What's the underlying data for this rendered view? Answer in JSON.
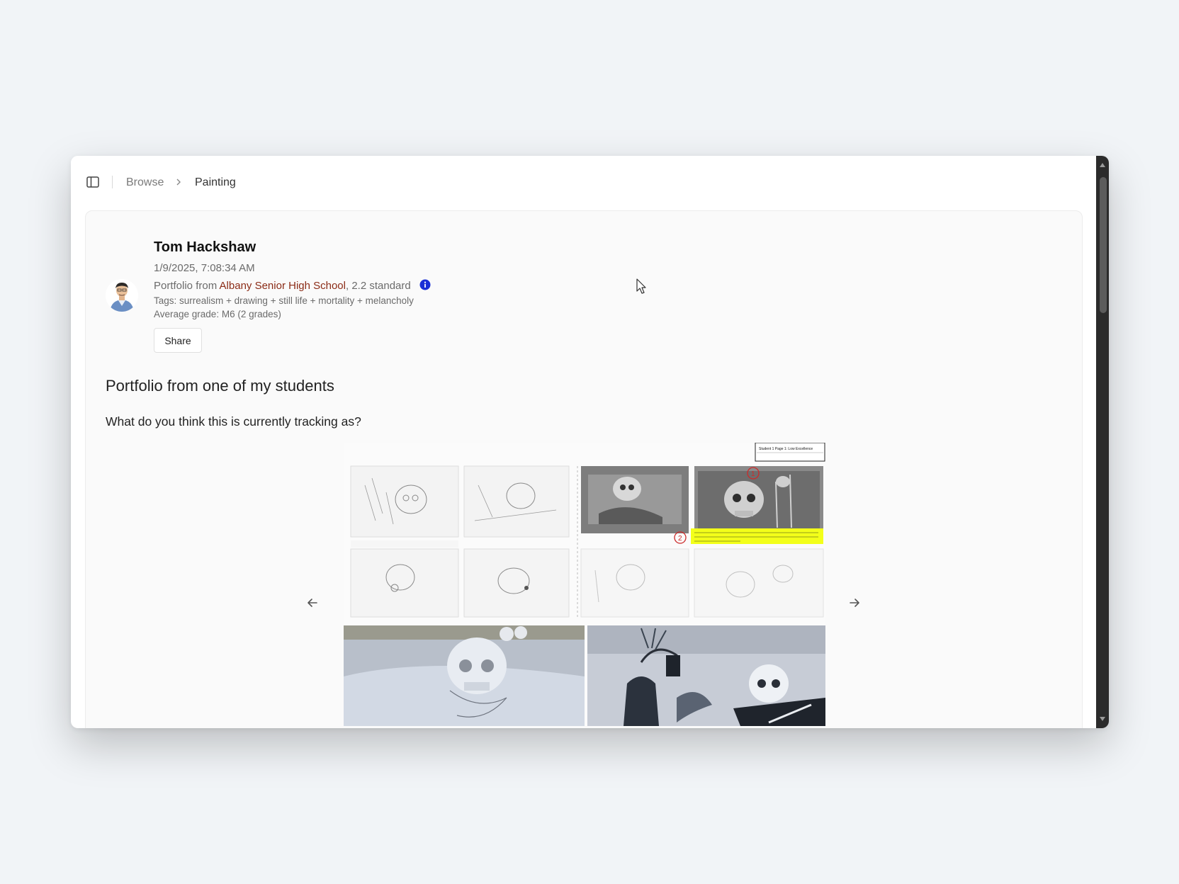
{
  "breadcrumb": {
    "items": [
      "Browse",
      "Painting"
    ]
  },
  "post": {
    "author": "Tom Hackshaw",
    "date": "1/9/2025, 7:08:34 AM",
    "portfolio_prefix": "Portfolio from ",
    "school": "Albany Senior High School",
    "standard": ", 2.2 standard",
    "tags": "Tags: surrealism + drawing + still life + mortality + melancholy",
    "average_grade": "Average grade: M6 (2 grades)",
    "share_label": "Share",
    "title": "Portfolio from one of my students",
    "body": "What do you think this is currently tracking as?"
  },
  "portfolio_image": {
    "header_label": "Student 1 Page 1: Low Excellence",
    "marker_1": "1",
    "marker_2": "2"
  },
  "colors": {
    "accent_link": "#8b2b16",
    "info_blue": "#1a2fd6",
    "highlight": "#f3ff1a"
  }
}
